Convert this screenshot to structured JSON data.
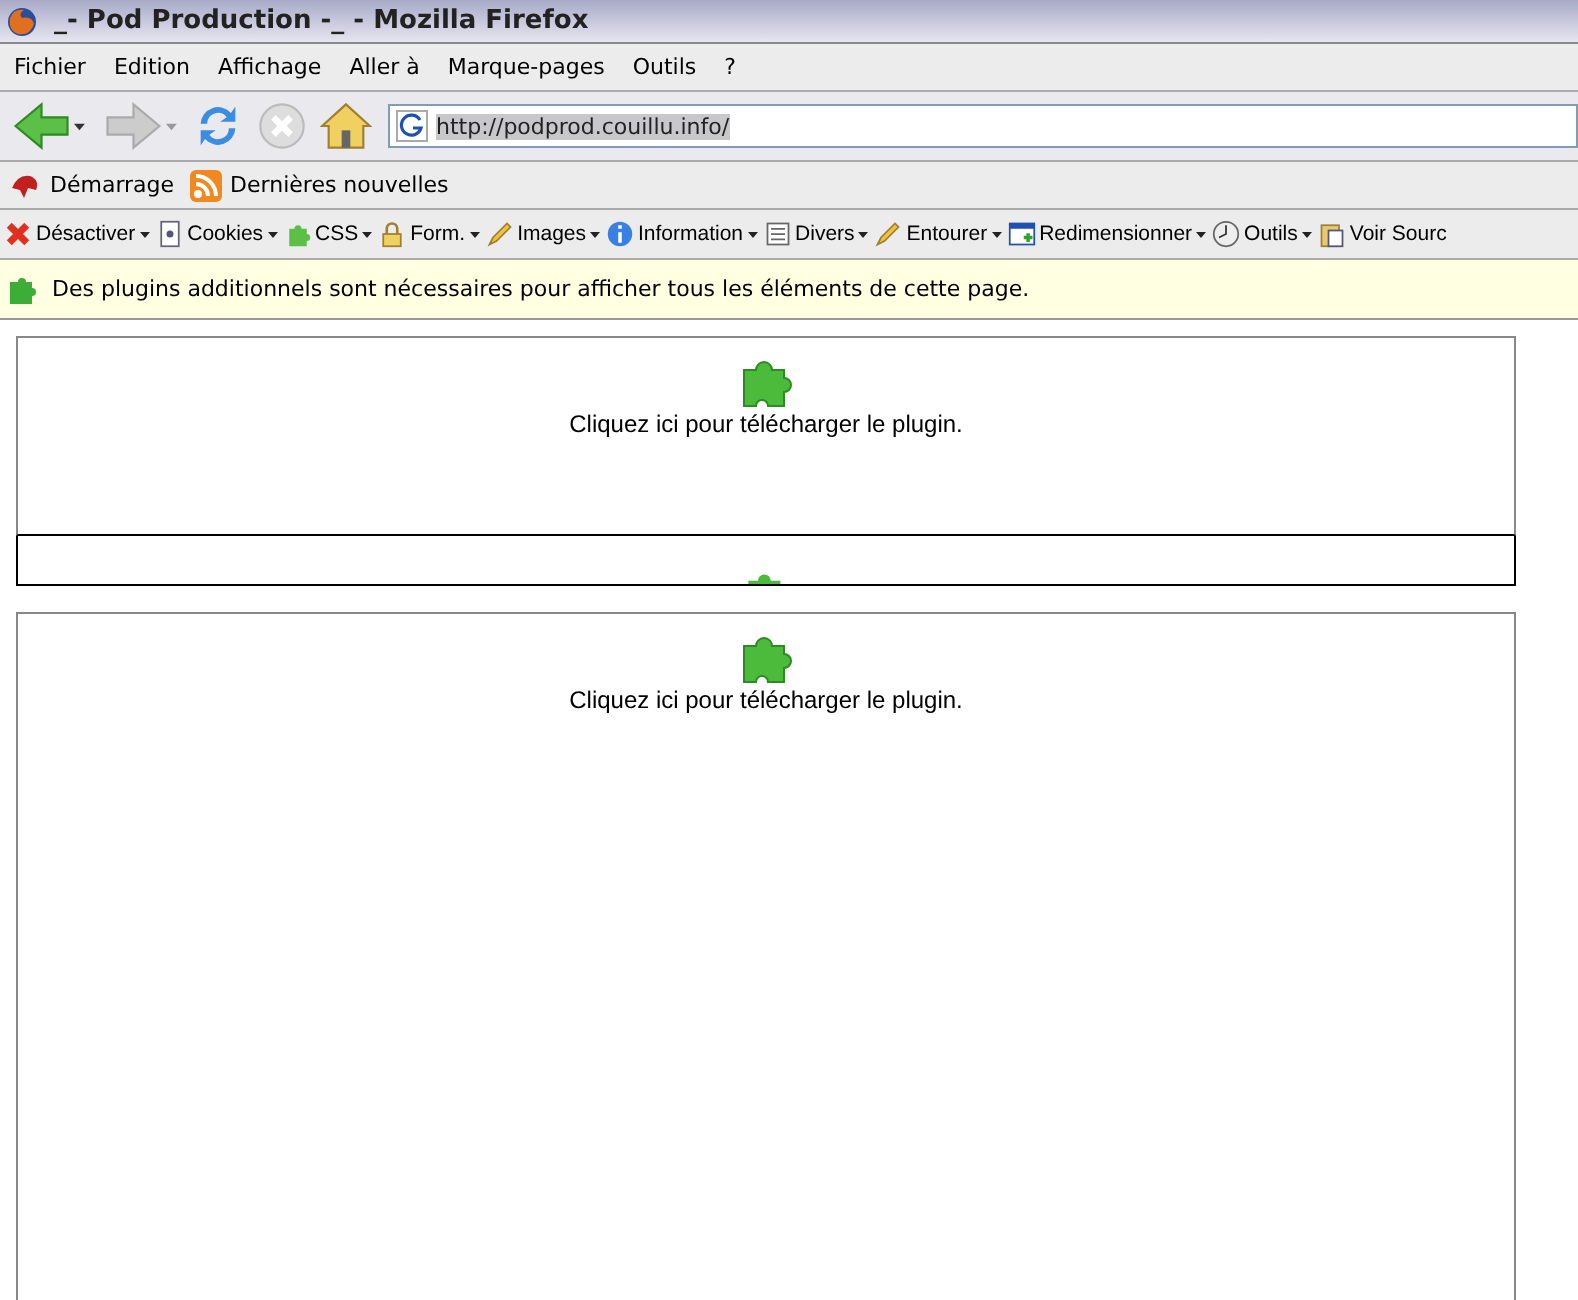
{
  "window": {
    "title": "_- Pod Production -_ - Mozilla Firefox"
  },
  "menu": [
    "Fichier",
    "Edition",
    "Affichage",
    "Aller à",
    "Marque-pages",
    "Outils",
    "?"
  ],
  "address": {
    "value": "http://podprod.couillu.info/"
  },
  "bookmarks": [
    "Démarrage",
    "Dernières nouvelles"
  ],
  "dev_toolbar": [
    "Désactiver",
    "Cookies",
    "CSS",
    "Form.",
    "Images",
    "Information",
    "Divers",
    "Entourer",
    "Redimensionner",
    "Outils",
    "Voir Sourc"
  ],
  "notification": "Des plugins additionnels sont nécessaires pour afficher tous les éléments de cette page.",
  "plugins": [
    {
      "kind": "full",
      "text": "Cliquez ici pour télécharger le plugin."
    },
    {
      "kind": "cut"
    },
    {
      "kind": "full",
      "text": "Cliquez ici pour télécharger le plugin."
    }
  ]
}
